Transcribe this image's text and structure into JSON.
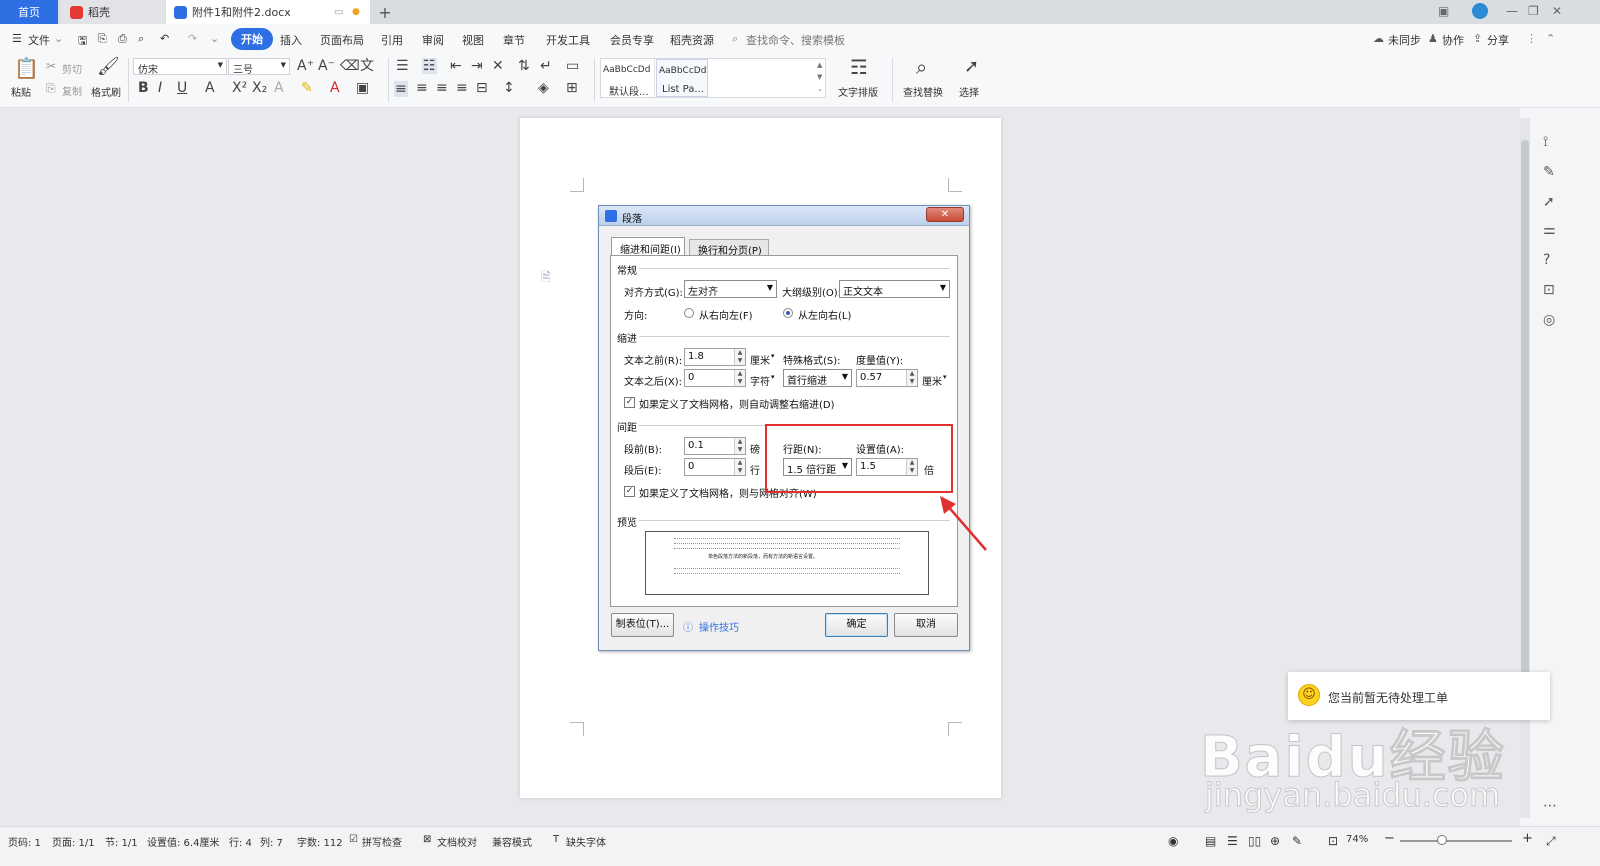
{
  "tabs": {
    "home": "首页",
    "daoke": "稻壳",
    "doc": "附件1和附件2.docx",
    "add": "+"
  },
  "menu": {
    "file": "文件",
    "start": "开始",
    "insert": "插入",
    "layout": "页面布局",
    "reference": "引用",
    "review": "审阅",
    "view": "视图",
    "section": "章节",
    "devtools": "开发工具",
    "member": "会员专享",
    "resources": "稻壳资源",
    "search": "查找命令、搜索模板",
    "unsync": "未同步",
    "collab": "协作",
    "share": "分享"
  },
  "ribbon": {
    "paste": "粘贴",
    "cut": "剪切",
    "copy": "复制",
    "format_painter": "格式刷",
    "font_name": "仿宋",
    "font_size": "三号",
    "style1_preview": "AaBbCcDd",
    "style1_name": "默认段...",
    "style2_preview": "AaBbCcDd",
    "style2_name": "List Pa...",
    "text_layout": "文字排版",
    "find_replace": "查找替换",
    "select": "选择"
  },
  "dialog": {
    "title": "段落",
    "tab_indent": "缩进和间距(I)",
    "tab_break": "换行和分页(P)",
    "group_general": "常规",
    "align_label": "对齐方式(G):",
    "align_value": "左对齐",
    "outline_label": "大纲级别(O):",
    "outline_value": "正文文本",
    "direction_label": "方向:",
    "rtl_label": "从右向左(F)",
    "ltr_label": "从左向右(L)",
    "group_indent": "缩进",
    "before_text_label": "文本之前(R):",
    "before_text_value": "1.8",
    "before_text_unit": "厘米",
    "special_label": "特殊格式(S):",
    "measure_label": "度量值(Y):",
    "after_text_label": "文本之后(X):",
    "after_text_value": "0",
    "after_text_unit": "字符",
    "special_value": "首行缩进",
    "measure_value": "0.57",
    "measure_unit": "厘米",
    "auto_indent_label": "如果定义了文档网格，则自动调整右缩进(D)",
    "group_spacing": "间距",
    "before_para_label": "段前(B):",
    "before_para_value": "0.1",
    "before_para_unit": "磅",
    "line_spacing_label": "行距(N):",
    "set_value_label": "设置值(A):",
    "after_para_label": "段后(E):",
    "after_para_value": "0",
    "after_para_unit": "行",
    "line_spacing_value": "1.5 倍行距",
    "set_value": "1.5",
    "set_value_unit": "倍",
    "grid_align_label": "如果定义了文档网格，则与网格对齐(W)",
    "group_preview": "预览",
    "preview_bold_line": "单色段落方法的新段落，而有方法的新语言设置。",
    "tabs_button": "制表位(T)...",
    "tips_link": "操作技巧",
    "ok_button": "确定",
    "cancel_button": "取消"
  },
  "status": {
    "page_num": "页码: 1",
    "pages": "页面: 1/1",
    "section": "节: 1/1",
    "set_value": "设置值: 6.4厘米",
    "row": "行: 4",
    "col": "列: 7",
    "word_count": "字数: 112",
    "spell_check": "拼写检查",
    "doc_proof": "文档校对",
    "compat_mode": "兼容模式",
    "missing_font": "缺失字体",
    "zoom": "74%"
  },
  "toast": {
    "text": "您当前暂无待处理工单"
  },
  "watermark": {
    "brand": "Baidu经验",
    "url": "jingyan.baidu.com"
  },
  "colors": {
    "accent": "#2f6fe4",
    "highlight_box": "#e03030"
  }
}
